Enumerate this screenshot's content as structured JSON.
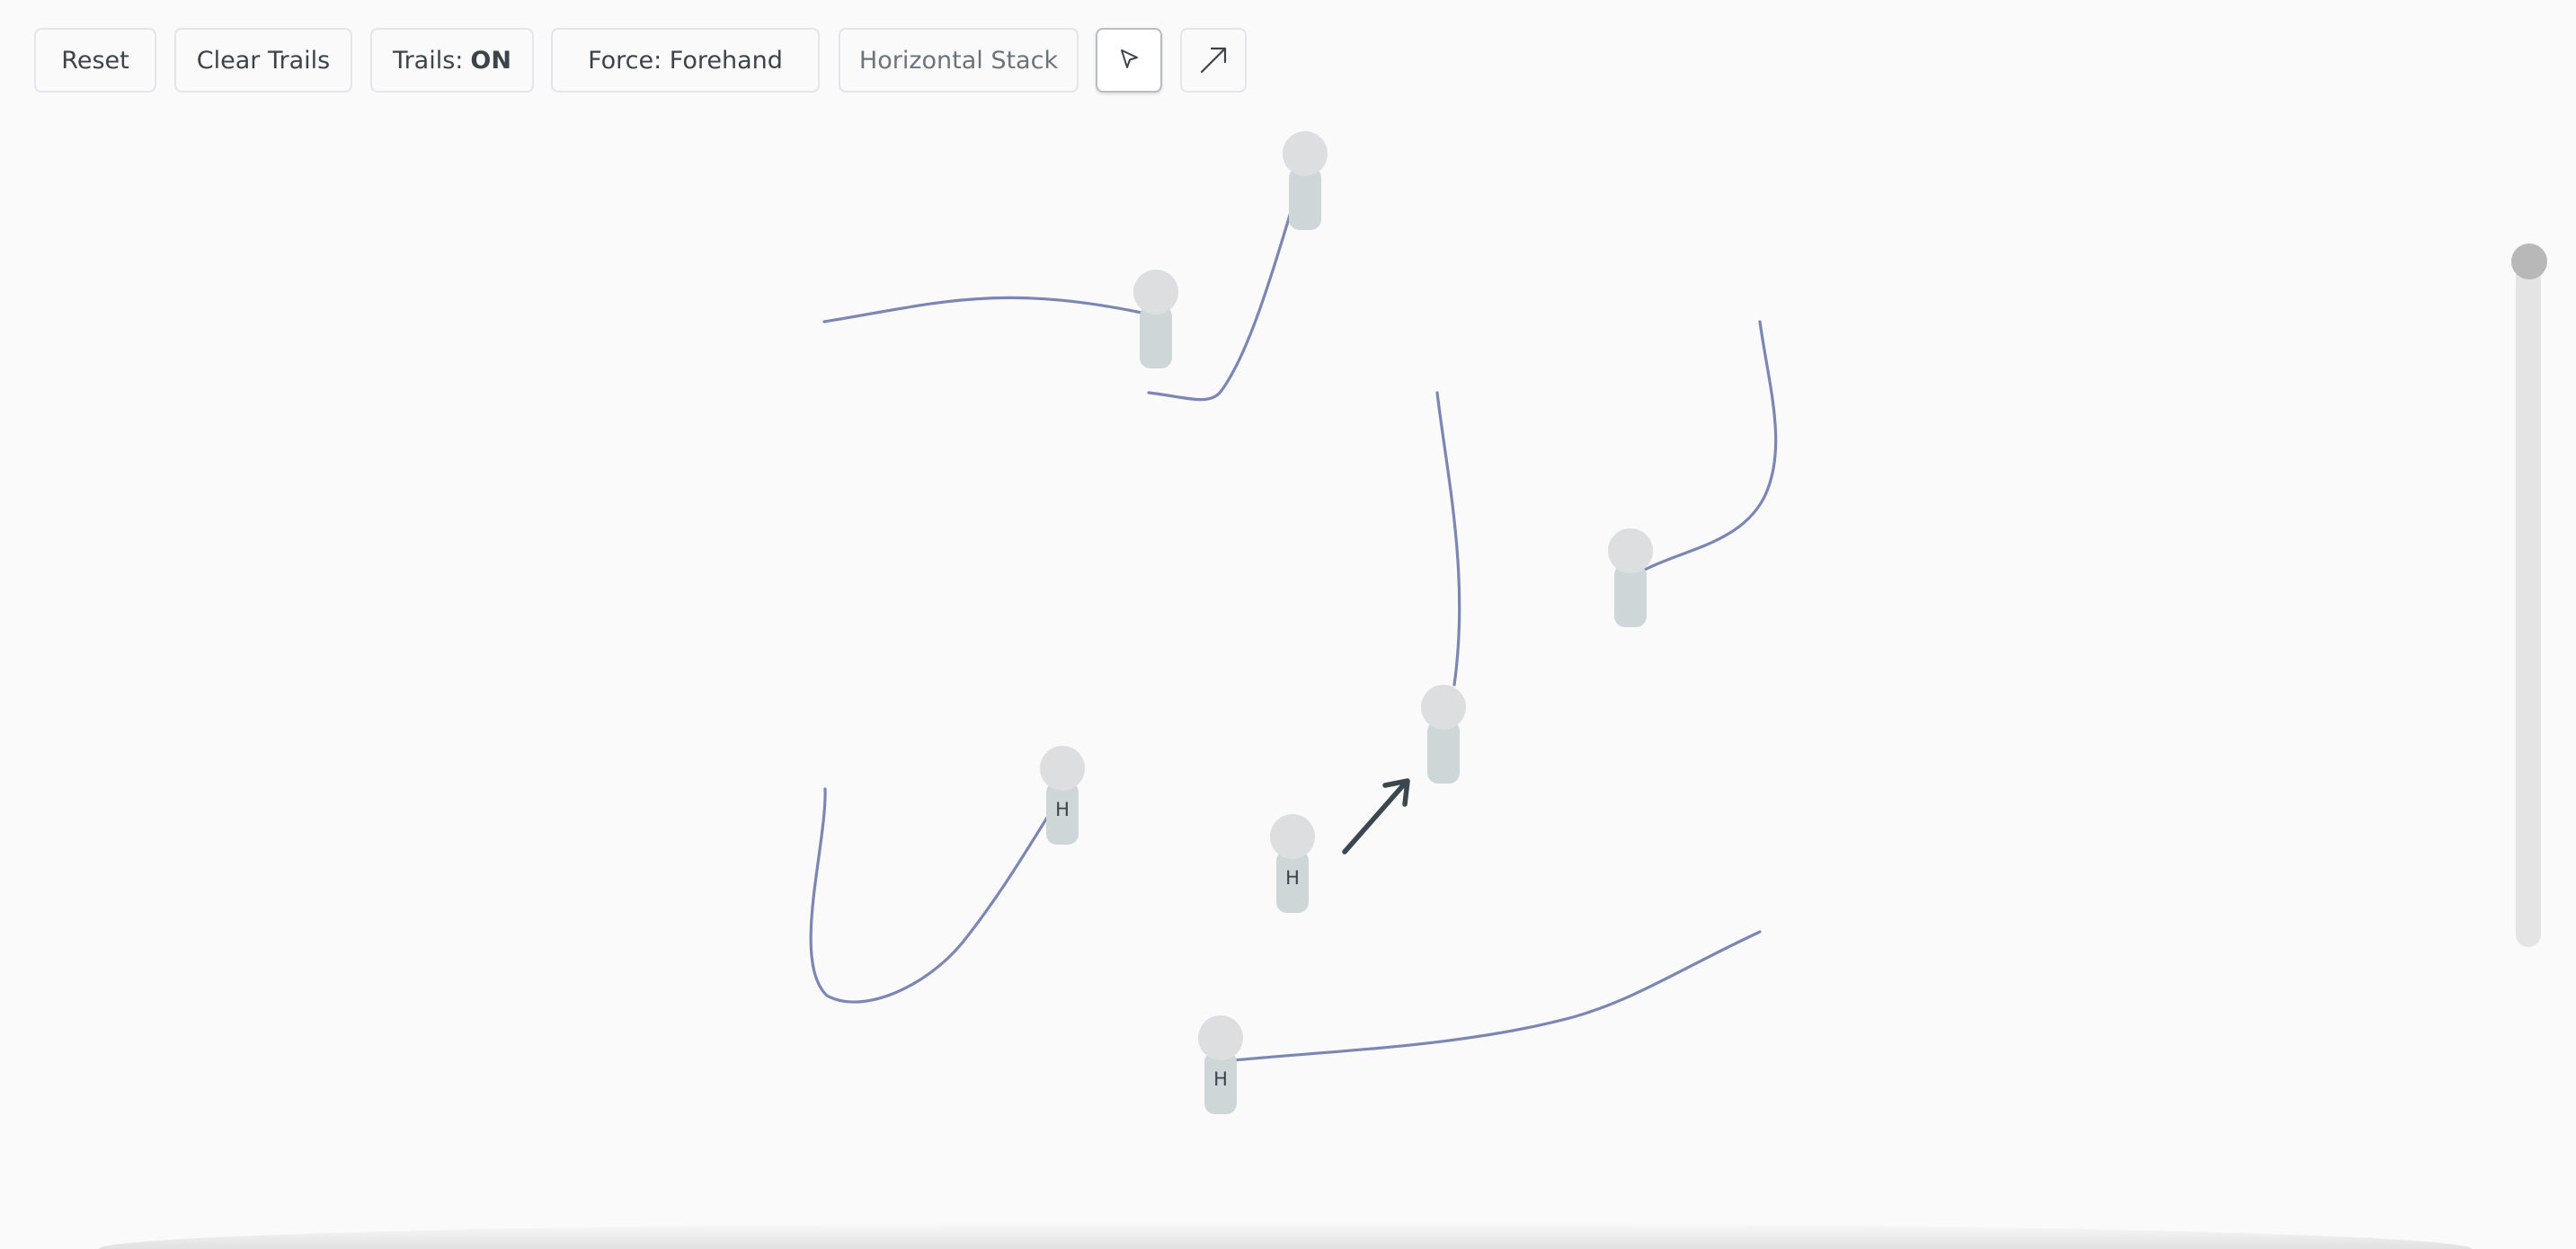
{
  "toolbar": {
    "reset_label": "Reset",
    "clear_trails_label": "Clear Trails",
    "trails_label": "Trails:",
    "trails_state": "ON",
    "force_label": "Force: Forehand",
    "formation_label": "Horizontal Stack",
    "select_tool_icon": "cursor-arrow-icon",
    "arrow_tool_icon": "diagonal-arrow-icon",
    "active_tool": "select"
  },
  "players": [
    {
      "label": ""
    },
    {
      "label": ""
    },
    {
      "label": ""
    },
    {
      "label": ""
    },
    {
      "label": "H"
    },
    {
      "label": "H"
    },
    {
      "label": "H"
    }
  ],
  "colors": {
    "background": "#fafafa",
    "trail": "#7b86b4",
    "player_head": "#dcdee0",
    "player_body": "#ced6d8",
    "arrow": "#3b474f"
  }
}
